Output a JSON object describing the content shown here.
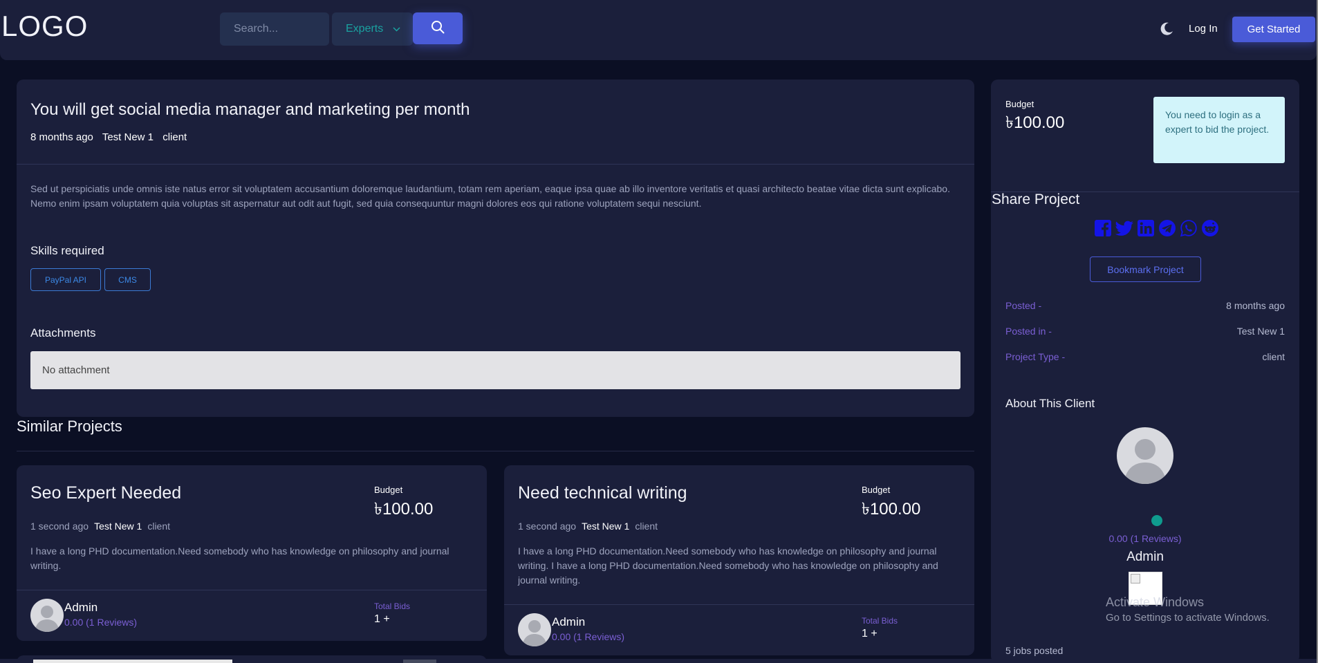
{
  "header": {
    "logo": "LOGO",
    "search_placeholder": "Search...",
    "search_category": "Experts",
    "login": "Log In",
    "get_started": "Get Started"
  },
  "project": {
    "title": "You will get social media manager and marketing per month",
    "posted_ago": "8 months ago",
    "category": "Test New 1",
    "type": "client",
    "description": "Sed ut perspiciatis unde omnis iste natus error sit voluptatem accusantium doloremque laudantium, totam rem aperiam, eaque ipsa quae ab illo inventore veritatis et quasi architecto beatae vitae dicta sunt explicabo. Nemo enim ipsam voluptatem quia voluptas sit aspernatur aut odit aut fugit, sed quia consequuntur magni dolores eos qui ratione voluptatem sequi nesciunt.",
    "skills_title": "Skills required",
    "skills": [
      "PayPal API",
      "CMS"
    ],
    "attachments_title": "Attachments",
    "attachments_empty": "No attachment"
  },
  "similar": {
    "title": "Similar Projects",
    "items": [
      {
        "title": "Seo Expert Needed",
        "budget_label": "Budget",
        "budget": "৳100.00",
        "posted_ago": "1 second ago",
        "category": "Test New 1",
        "type": "client",
        "description": "I have a long PHD documentation.Need somebody who has knowledge on philosophy and journal writing.",
        "author": "Admin",
        "rating": "0.00 (1 Reviews)",
        "bids_label": "Total Bids",
        "bids": "1 +"
      },
      {
        "title": "Need technical writing",
        "budget_label": "Budget",
        "budget": "৳100.00",
        "posted_ago": "1 second ago",
        "category": "Test New 1",
        "type": "client",
        "description": "I have a long PHD documentation.Need somebody who has knowledge on philosophy and journal writing. I have a long PHD documentation.Need somebody who has knowledge on philosophy and journal writing.",
        "author": "Admin",
        "rating": "0.00 (1 Reviews)",
        "bids_label": "Total Bids",
        "bids": "1 +"
      }
    ]
  },
  "sidebar": {
    "budget_label": "Budget",
    "budget": "৳100.00",
    "login_notice": "You need to login as a expert to bid the project.",
    "share_title": "Share Project",
    "share_icons": [
      "facebook-icon",
      "twitter-icon",
      "linkedin-icon",
      "telegram-icon",
      "whatsapp-icon",
      "reddit-icon"
    ],
    "bookmark": "Bookmark Project",
    "posted_label": "Posted -",
    "posted_value": "8 months ago",
    "posted_in_label": "Posted in -",
    "posted_in_value": "Test New 1",
    "type_label": "Project Type -",
    "type_value": "client",
    "about_title": "About This Client",
    "client_rating": "0.00 (1 Reviews)",
    "client_name": "Admin",
    "jobs_posted": "5 jobs posted"
  },
  "watermark": {
    "line1": "Activate Windows",
    "line2": "Go to Settings to activate Windows."
  },
  "colors": {
    "background": "#0b0f24",
    "card": "#1b1f3b",
    "accent": "#4a5bd8",
    "rating": "#7b5fd4",
    "share_icons": "#1414e6"
  }
}
